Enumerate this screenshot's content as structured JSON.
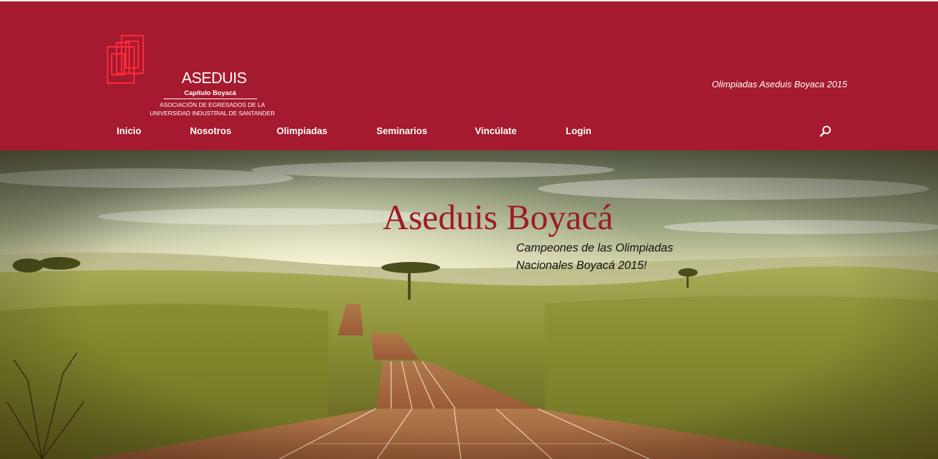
{
  "brand": {
    "name": "ASEDUIS",
    "chapter": "Capítulo Boyacá",
    "tagline_lines": [
      "ASOCIACIÓN DE EGRESADOS DE LA",
      "UNIVERSIDAD INDUSTRIAL DE SANTANDER"
    ],
    "color": "#a51a2e"
  },
  "header": {
    "tagline": "Olimpiadas Aseduis Boyaca 2015"
  },
  "nav": {
    "items": [
      {
        "label": "Inicio"
      },
      {
        "label": "Nosotros"
      },
      {
        "label": "Olimpiadas"
      },
      {
        "label": "Seminarios"
      },
      {
        "label": "Vincúlate"
      },
      {
        "label": "Login"
      }
    ],
    "search_icon": "search-icon"
  },
  "hero": {
    "title": "Aseduis Boyacá",
    "subtitle_lines": [
      "Campeones de las Olimpiadas",
      "Nacionales Boyacá 2015!"
    ],
    "title_color": "#9c1b27"
  }
}
